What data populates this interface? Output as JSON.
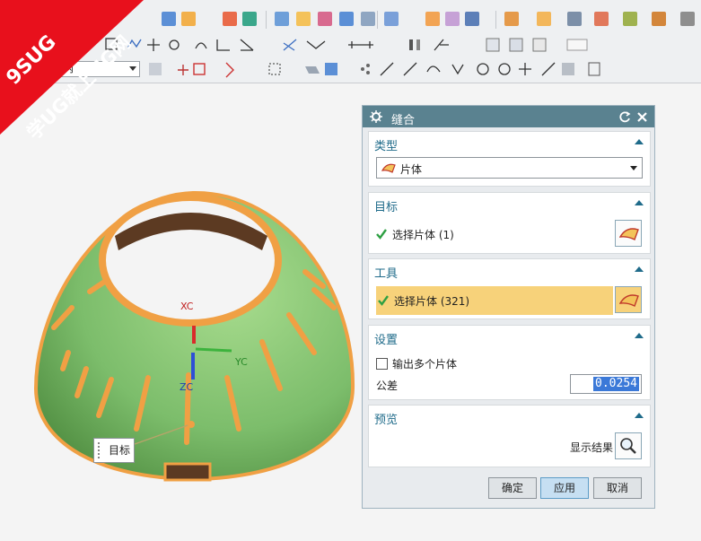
{
  "banner": {
    "brand": "9SUG",
    "slogan": "学UG就上UG网"
  },
  "toolbar": {
    "filter_value": "内"
  },
  "viewport": {
    "axis_x": "XC",
    "axis_y": "YC",
    "axis_z": "ZC",
    "target_label": "目标"
  },
  "dialog": {
    "title": "缝合",
    "type": {
      "header": "类型",
      "value": "片体"
    },
    "target": {
      "header": "目标",
      "select_label": "选择片体 (1)"
    },
    "tool": {
      "header": "工具",
      "select_label": "选择片体 (321)"
    },
    "settings": {
      "header": "设置",
      "multi_label": "输出多个片体",
      "tol_label": "公差",
      "tol_value": "0.0254"
    },
    "preview": {
      "header": "预览",
      "show_label": "显示结果"
    },
    "buttons": {
      "ok": "确定",
      "apply": "应用",
      "cancel": "取消"
    }
  },
  "colors": {
    "dialog_title": "#5a8290",
    "section_header": "#1f6b8a",
    "tool_highlight": "#f7d27a",
    "model_green": "#7cbd6b",
    "model_edge": "#f0a044",
    "banner_red": "#e8101c"
  }
}
